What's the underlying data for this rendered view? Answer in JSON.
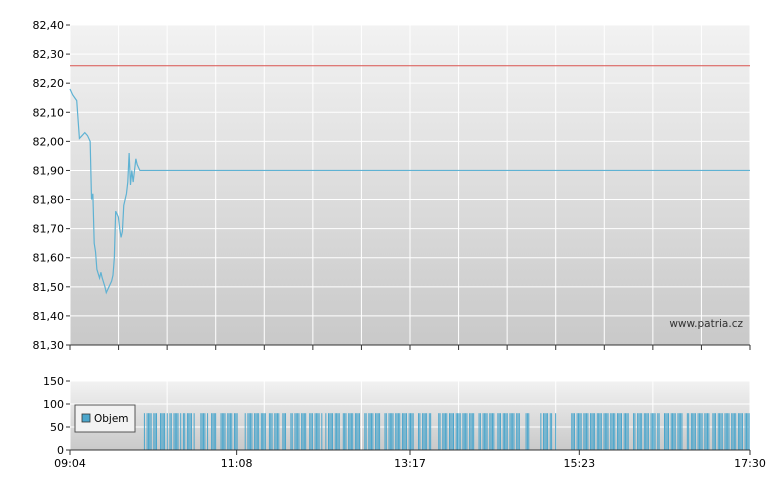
{
  "colors": {
    "price_line": "#5fb2d3",
    "reference_line": "#d9534f",
    "volume_bars": "#4ba6cc",
    "grid": "#ffffff",
    "plot_bg_top": "#f2f2f2",
    "plot_bg_bottom": "#c9c9c9",
    "axis": "#333333"
  },
  "watermark": "www.patria.cz",
  "legend": {
    "label": "Objem"
  },
  "chart_data": [
    {
      "type": "line",
      "name": "price",
      "ylim": [
        81.3,
        82.4
      ],
      "yticks": [
        "82,40",
        "82,30",
        "82,20",
        "82,10",
        "82,00",
        "81,90",
        "81,80",
        "81,70",
        "81,60",
        "81,50",
        "81,40",
        "81,30"
      ],
      "ytick_values": [
        82.4,
        82.3,
        82.2,
        82.1,
        82.0,
        81.9,
        81.8,
        81.7,
        81.6,
        81.5,
        81.4,
        81.3
      ],
      "x_range_minutes": [
        544,
        1050
      ],
      "reference_value": 82.26,
      "series": [
        {
          "points": [
            [
              544,
              82.18
            ],
            [
              546,
              82.16
            ],
            [
              549,
              82.14
            ],
            [
              551,
              82.01
            ],
            [
              553,
              82.02
            ],
            [
              555,
              82.03
            ],
            [
              557,
              82.02
            ],
            [
              559,
              82.0
            ],
            [
              560,
              81.8
            ],
            [
              561,
              81.82
            ],
            [
              562,
              81.65
            ],
            [
              563,
              81.62
            ],
            [
              564,
              81.56
            ],
            [
              566,
              81.53
            ],
            [
              567,
              81.55
            ],
            [
              568,
              81.53
            ],
            [
              570,
              81.5
            ],
            [
              571,
              81.48
            ],
            [
              573,
              81.5
            ],
            [
              575,
              81.52
            ],
            [
              576,
              81.54
            ],
            [
              577,
              81.6
            ],
            [
              578,
              81.76
            ],
            [
              580,
              81.74
            ],
            [
              581,
              81.7
            ],
            [
              582,
              81.67
            ],
            [
              583,
              81.69
            ],
            [
              584,
              81.78
            ],
            [
              586,
              81.82
            ],
            [
              587,
              81.86
            ],
            [
              588,
              81.96
            ],
            [
              589,
              81.85
            ],
            [
              590,
              81.9
            ],
            [
              591,
              81.86
            ],
            [
              592,
              81.9
            ],
            [
              593,
              81.94
            ],
            [
              594,
              81.92
            ],
            [
              596,
              81.9
            ],
            [
              1050,
              81.9
            ]
          ]
        }
      ],
      "grid": true
    },
    {
      "type": "bar",
      "name": "volume",
      "ylim": [
        0,
        150
      ],
      "yticks": [
        "150",
        "100",
        "50",
        "0"
      ],
      "ytick_values": [
        150,
        100,
        50,
        0
      ],
      "xticks": [
        "09:04",
        "11:08",
        "13:17",
        "15:23",
        "17:30"
      ],
      "xtick_minutes": [
        544,
        668,
        797,
        923,
        1050
      ],
      "bar_value": 80,
      "active_minutes_ranges": [
        [
          599,
          608
        ],
        [
          610,
          616
        ],
        [
          618,
          626
        ],
        [
          628,
          636
        ],
        [
          640,
          646
        ],
        [
          649,
          652
        ],
        [
          656,
          668
        ],
        [
          674,
          681
        ],
        [
          682,
          690
        ],
        [
          692,
          700
        ],
        [
          702,
          704
        ],
        [
          708,
          720
        ],
        [
          722,
          731
        ],
        [
          734,
          744
        ],
        [
          747,
          760
        ],
        [
          763,
          775
        ],
        [
          778,
          800
        ],
        [
          803,
          812
        ],
        [
          818,
          845
        ],
        [
          848,
          860
        ],
        [
          862,
          878
        ],
        [
          883,
          885
        ],
        [
          894,
          902
        ],
        [
          905,
          905
        ],
        [
          917,
          944
        ],
        [
          946,
          960
        ],
        [
          963,
          982
        ],
        [
          986,
          1000
        ],
        [
          1003,
          1020
        ],
        [
          1022,
          1050
        ]
      ],
      "grid": true
    }
  ]
}
